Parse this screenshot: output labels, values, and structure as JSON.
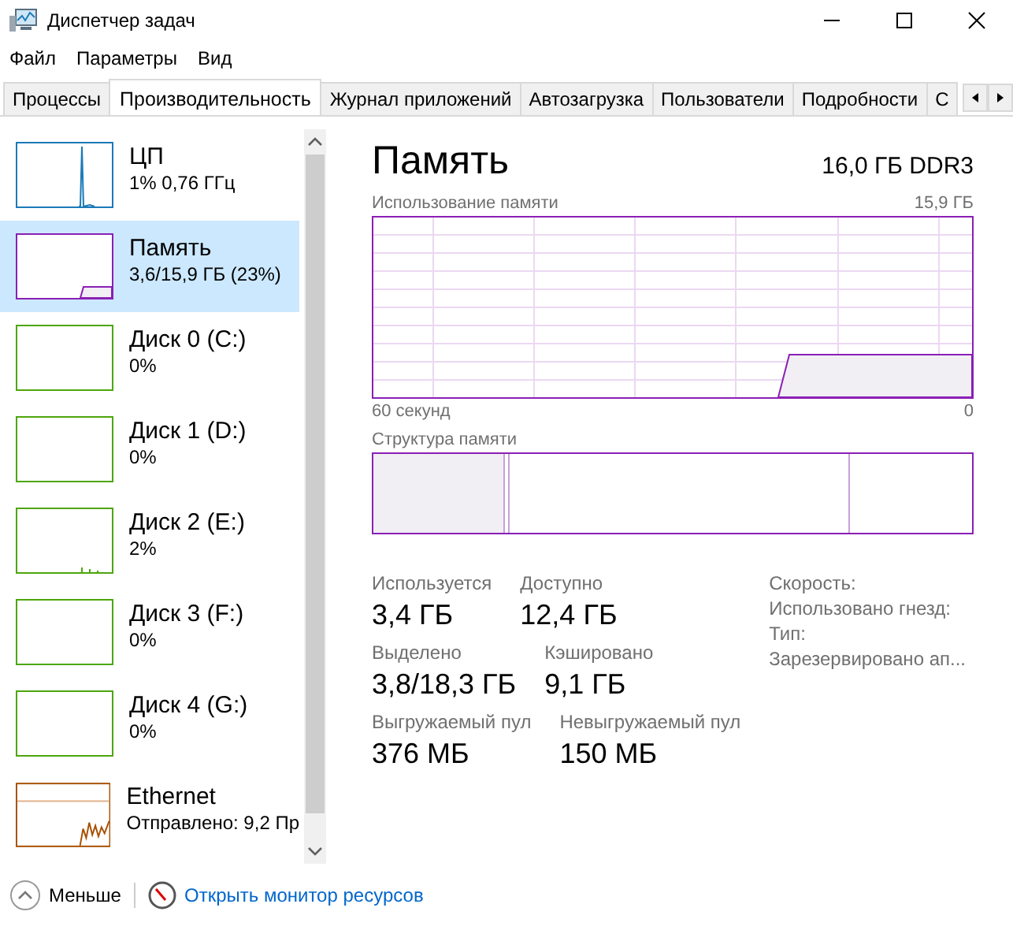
{
  "window": {
    "title": "Диспетчер задач"
  },
  "menu": [
    "Файл",
    "Параметры",
    "Вид"
  ],
  "tabs": [
    {
      "label": "Процессы",
      "selected": false
    },
    {
      "label": "Производительность",
      "selected": true
    },
    {
      "label": "Журнал приложений",
      "selected": false
    },
    {
      "label": "Автозагрузка",
      "selected": false
    },
    {
      "label": "Пользователи",
      "selected": false
    },
    {
      "label": "Подробности",
      "selected": false
    },
    {
      "label": "С",
      "selected": false
    }
  ],
  "sidebar": {
    "items": [
      {
        "kind": "cpu",
        "name": "ЦП",
        "detail": "1% 0,76 ГГц",
        "color": "#1c7ab8",
        "selected": false
      },
      {
        "kind": "memory",
        "name": "Память",
        "detail": "3,6/15,9 ГБ (23%)",
        "color": "#8b1fb5",
        "selected": true
      },
      {
        "kind": "disk",
        "name": "Диск 0 (C:)",
        "detail": "0%",
        "color": "#4da60c",
        "selected": false
      },
      {
        "kind": "disk",
        "name": "Диск 1 (D:)",
        "detail": "0%",
        "color": "#4da60c",
        "selected": false
      },
      {
        "kind": "disk",
        "name": "Диск 2 (E:)",
        "detail": "2%",
        "color": "#4da60c",
        "selected": false
      },
      {
        "kind": "disk",
        "name": "Диск 3 (F:)",
        "detail": "0%",
        "color": "#4da60c",
        "selected": false
      },
      {
        "kind": "disk",
        "name": "Диск 4 (G:)",
        "detail": "0%",
        "color": "#4da60c",
        "selected": false
      },
      {
        "kind": "ethernet",
        "name": "Ethernet",
        "detail": "Отправлено: 9,2 Пр",
        "color": "#a74f01",
        "selected": false
      }
    ]
  },
  "panel": {
    "title": "Память",
    "subtitle": "16,0 ГБ DDR3",
    "usage_label": "Использование памяти",
    "usage_max": "15,9 ГБ",
    "time_start": "60 секунд",
    "time_end": "0",
    "structure_label": "Структура памяти",
    "stat_rows": [
      [
        {
          "label": "Используется",
          "value": "3,4 ГБ"
        },
        {
          "label": "Доступно",
          "value": "12,4 ГБ"
        }
      ],
      [
        {
          "label": "Выделено",
          "value": "3,8/18,3 ГБ"
        },
        {
          "label": "Кэшировано",
          "value": "9,1 ГБ"
        }
      ],
      [
        {
          "label": "Выгружаемый пул",
          "value": "376 МБ"
        },
        {
          "label": "Невыгружаемый пул",
          "value": "150 МБ"
        }
      ]
    ],
    "details": [
      "Скорость:",
      "Использовано гнезд:",
      "Тип:",
      "Зарезервировано ап..."
    ]
  },
  "footer": {
    "less": "Меньше",
    "monitor_link": "Открыть монитор ресурсов"
  }
}
